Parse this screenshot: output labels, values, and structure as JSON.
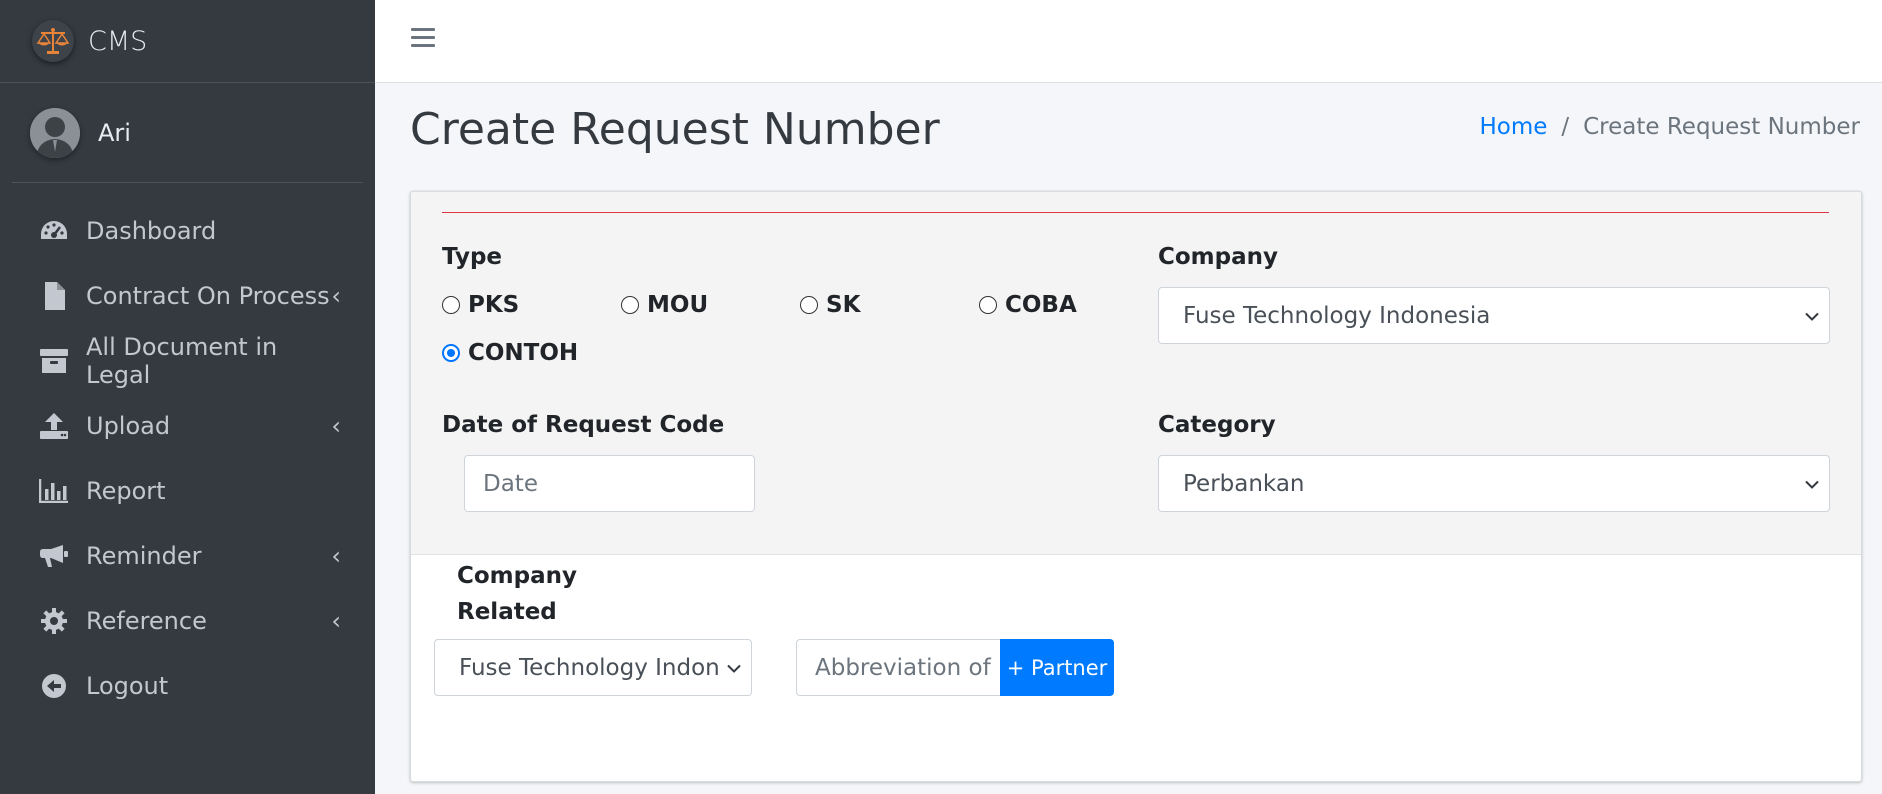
{
  "app": {
    "brand": "CMS",
    "user_name": "Ari"
  },
  "sidebar": {
    "items": [
      {
        "label": "Dashboard",
        "icon": "tachometer-icon",
        "has_children": false
      },
      {
        "label": "Contract On Process",
        "icon": "file-icon",
        "has_children": true
      },
      {
        "label": "All Document in Legal",
        "icon": "archive-icon",
        "has_children": false
      },
      {
        "label": "Upload",
        "icon": "upload-icon",
        "has_children": true
      },
      {
        "label": "Report",
        "icon": "chart-bar-icon",
        "has_children": false
      },
      {
        "label": "Reminder",
        "icon": "bullhorn-icon",
        "has_children": true
      },
      {
        "label": "Reference",
        "icon": "gear-icon",
        "has_children": true
      },
      {
        "label": "Logout",
        "icon": "logout-icon",
        "has_children": false
      }
    ]
  },
  "page": {
    "title": "Create Request Number",
    "breadcrumb": {
      "home": "Home",
      "current": "Create Request Number"
    }
  },
  "form": {
    "type_label": "Type",
    "type_options": [
      "PKS",
      "MOU",
      "SK",
      "COBA",
      "CONTOH"
    ],
    "type_selected": "CONTOH",
    "company_label": "Company",
    "company_value": "Fuse Technology Indonesia",
    "date_label": "Date of Request Code",
    "date_placeholder": "Date",
    "category_label": "Category",
    "category_value": "Perbankan",
    "company_related_label_line1": "Company",
    "company_related_label_line2": "Related",
    "company_related_value": "Fuse Technology Indon",
    "abbreviation_placeholder": "Abbreviation of",
    "partner_button": "+ Partner"
  },
  "colors": {
    "sidebar_bg": "#343a40",
    "primary": "#007bff",
    "accent_line": "#dc3545"
  }
}
